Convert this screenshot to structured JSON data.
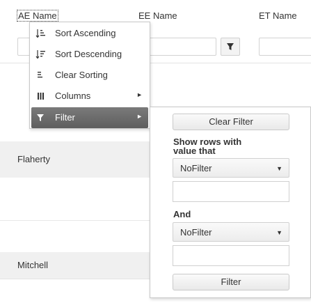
{
  "columns": [
    {
      "title": "AE Name",
      "active": true
    },
    {
      "title": "EE Name"
    },
    {
      "title": "ET Name"
    }
  ],
  "rows": [
    "",
    "Flaherty",
    "",
    "Mitchell"
  ],
  "menu": {
    "items": [
      {
        "label": "Sort Ascending",
        "icon": "sort-ascending-icon"
      },
      {
        "label": "Sort Descending",
        "icon": "sort-descending-icon"
      },
      {
        "label": "Clear Sorting",
        "icon": "clear-sorting-icon"
      },
      {
        "label": "Columns",
        "icon": "columns-icon",
        "submenu": true
      },
      {
        "label": "Filter",
        "icon": "filter-icon",
        "submenu": true,
        "selected": true
      }
    ]
  },
  "filter_panel": {
    "clear_button": "Clear Filter",
    "show_rows_label": "Show rows with value that",
    "operator1": "NoFilter",
    "value1": "",
    "and_label": "And",
    "operator2": "NoFilter",
    "value2": "",
    "filter_button": "Filter"
  },
  "colors": {
    "selected_menu_bg": "#6b6b6b",
    "alt_row_bg": "#f0f0f0"
  }
}
